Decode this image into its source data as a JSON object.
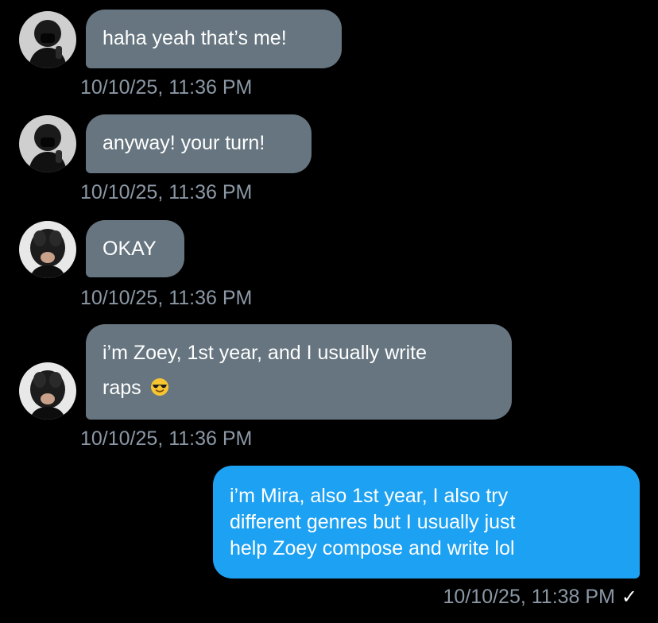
{
  "conversation": {
    "messages": [
      {
        "sender": "other-masked",
        "text": "haha yeah that’s me!",
        "timestamp": "10/10/25, 11:36 PM"
      },
      {
        "sender": "other-masked",
        "text": "anyway! your turn!",
        "timestamp": "10/10/25, 11:36 PM"
      },
      {
        "sender": "other-braids",
        "text": "OKAY",
        "timestamp": "10/10/25, 11:36 PM"
      },
      {
        "sender": "other-braids",
        "text_line1": "i’m Zoey, 1st year, and I usually write",
        "text_line2": "raps",
        "emoji": "smiling-face-with-sunglasses-icon",
        "timestamp": "10/10/25, 11:36 PM"
      },
      {
        "sender": "me",
        "text_line1": "i’m Mira, also 1st year, I also try",
        "text_line2": "different genres but I usually just",
        "text_line3": "help Zoey compose and write lol",
        "timestamp": "10/10/25, 11:38 PM",
        "status": "✓"
      }
    ]
  },
  "colors": {
    "background": "#000000",
    "incoming_bubble": "#66757f",
    "outgoing_bubble": "#1da1f2",
    "timestamp": "#8b98a5",
    "text": "#ffffff"
  }
}
